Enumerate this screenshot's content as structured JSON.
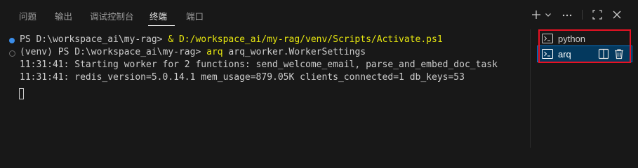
{
  "panel_tabs": [
    {
      "label": "问题"
    },
    {
      "label": "输出"
    },
    {
      "label": "调试控制台"
    },
    {
      "label": "终端"
    },
    {
      "label": "端口"
    }
  ],
  "active_tab": "终端",
  "icons": {
    "new_terminal": "plus-icon",
    "dropdown": "chevron-down-icon",
    "more": "ellipsis-icon",
    "maximize": "maximize-icon",
    "close": "close-icon",
    "terminal": "terminal-icon",
    "split": "split-icon",
    "trash": "trash-icon"
  },
  "terminal": {
    "lines": [
      {
        "prompt": "PS D:\\workspace_ai\\my-rag> ",
        "cmd": "& D:/workspace_ai/my-rag/venv/Scripts/Activate.ps1"
      },
      {
        "venv": "(venv) ",
        "prompt": "PS D:\\workspace_ai\\my-rag> ",
        "cmd": "arq",
        "args": " arq_worker.WorkerSettings"
      },
      {
        "text": "11:31:41: Starting worker for 2 functions: send_welcome_email, parse_and_embed_doc_task"
      },
      {
        "text": "11:31:41: redis_version=5.0.14.1 mem_usage=879.05K clients_connected=1 db_keys=53"
      }
    ]
  },
  "terminal_tabs": [
    {
      "label": "python"
    },
    {
      "label": "arq",
      "selected": true
    }
  ],
  "colors": {
    "background": "#181818",
    "highlight_border": "#e81123",
    "selected_bg": "#04395e",
    "command_yellow": "#e5e510",
    "decoration_blue": "#3b8eea"
  }
}
